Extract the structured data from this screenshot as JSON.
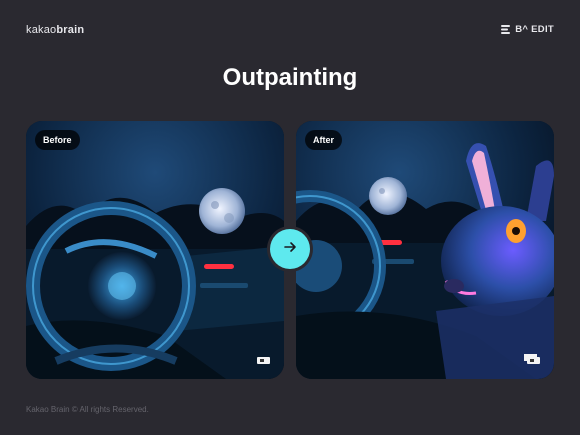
{
  "header": {
    "brand_prefix": "kakao",
    "brand_suffix": "brain",
    "product_label": "B^ EDIT"
  },
  "main": {
    "title": "Outpainting",
    "before_label": "Before",
    "after_label": "After",
    "arrow_icon": "arrow-right-icon"
  },
  "footer": {
    "copyright": "Kakao Brain © All rights Reserved."
  },
  "colors": {
    "background": "#2a2930",
    "accent": "#5ee9ee",
    "footer_text": "#65646c"
  }
}
